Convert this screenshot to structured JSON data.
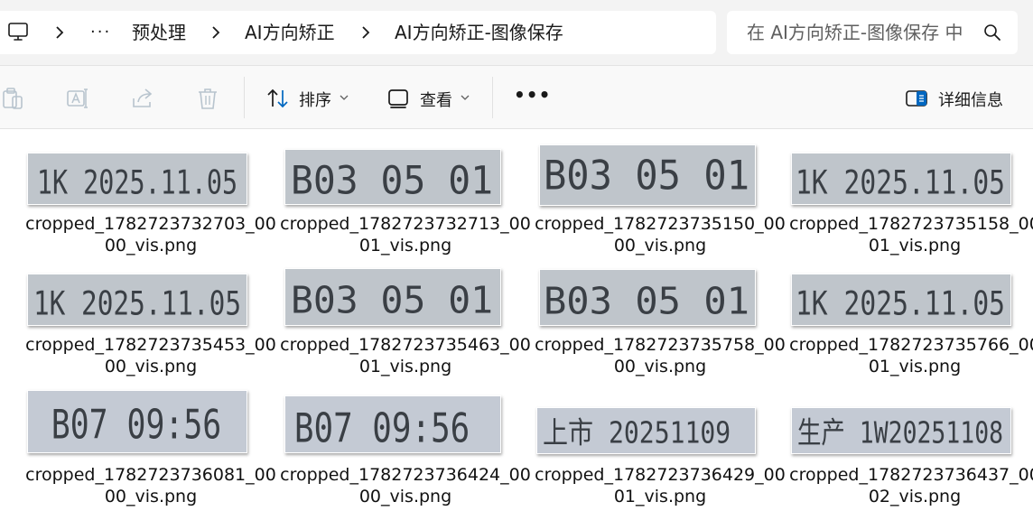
{
  "address_bar": {
    "overflow_label": "···",
    "breadcrumbs": [
      "预处理",
      "AI方向矫正",
      "AI方向矫正-图像保存"
    ]
  },
  "search": {
    "placeholder": "在 AI方向矫正-图像保存 中搜索"
  },
  "toolbar": {
    "sort_label": "排序",
    "view_label": "查看",
    "more_label": "•••",
    "details_label": "详细信息"
  },
  "files": [
    {
      "name_line1": "cropped_1782723732703_00",
      "name_line2": "00_vis.png",
      "stamp": "1K 2025.11.05"
    },
    {
      "name_line1": "cropped_1782723732713_00",
      "name_line2": "01_vis.png",
      "stamp": "B03  05  01"
    },
    {
      "name_line1": "cropped_1782723735150_00",
      "name_line2": "00_vis.png",
      "stamp": "B03  05  01"
    },
    {
      "name_line1": "cropped_1782723735158_00",
      "name_line2": "01_vis.png",
      "stamp": "1K 2025.11.05"
    },
    {
      "name_line1": "cropped_1782723735453_00",
      "name_line2": "00_vis.png",
      "stamp": "1K 2025.11.05"
    },
    {
      "name_line1": "cropped_1782723735463_00",
      "name_line2": "01_vis.png",
      "stamp": "B03  05  01"
    },
    {
      "name_line1": "cropped_1782723735758_00",
      "name_line2": "00_vis.png",
      "stamp": "B03  05  01"
    },
    {
      "name_line1": "cropped_1782723735766_00",
      "name_line2": "01_vis.png",
      "stamp": "1K 2025.11.05"
    },
    {
      "name_line1": "cropped_1782723736081_00",
      "name_line2": "00_vis.png",
      "stamp": "B07 09:56"
    },
    {
      "name_line1": "cropped_1782723736424_00",
      "name_line2": "00_vis.png",
      "stamp": "B07 09:56"
    },
    {
      "name_line1": "cropped_1782723736429_00",
      "name_line2": "01_vis.png",
      "stamp": "上市  20251109"
    },
    {
      "name_line1": "cropped_1782723736437_00",
      "name_line2": "02_vis.png",
      "stamp": "生产  1W20251108"
    }
  ],
  "colors": {
    "accent": "#0067c0",
    "toolbar_bg": "#f9f9f9",
    "addr_bg": "#f3f3f3",
    "thumb_bg": "#bfc5cb",
    "stamp_ink": "#3a3f45"
  },
  "icons": [
    "pc-icon",
    "chevron-right-icon",
    "search-icon",
    "copy-icon",
    "rename-icon",
    "share-icon",
    "delete-icon",
    "sort-icon",
    "view-icon",
    "chevron-down-icon",
    "details-pane-icon"
  ]
}
